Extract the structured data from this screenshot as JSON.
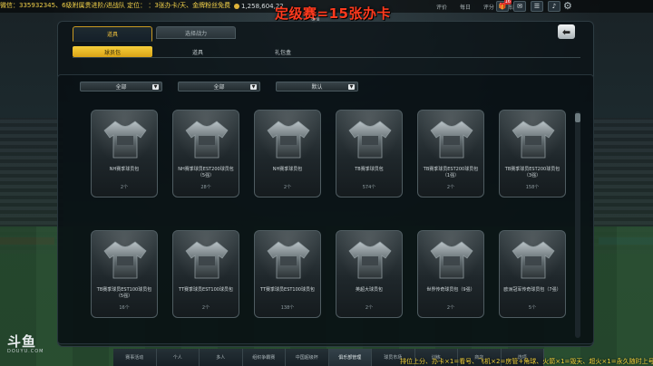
{
  "topbar": {
    "marquee": "微信：335932345、6级附属贵进阶/进战队   定位：    ：3张办卡/天、金牌粉丝免费",
    "stats": "1,258,604,22",
    "links": [
      "评价",
      "每日",
      "评分",
      "每周"
    ],
    "mail_badge": "16",
    "icons": [
      "gift-icon",
      "mail-icon",
      "message-icon",
      "bell-icon",
      "gear-icon"
    ]
  },
  "overlay": {
    "title": "定级赛=15张办卡",
    "subtitle": "道具"
  },
  "tabs_primary": [
    "道具",
    "选择战力"
  ],
  "tabs_secondary": [
    "球员包",
    "道具",
    "礼包盒"
  ],
  "filters": [
    "全部",
    "全部",
    "默认"
  ],
  "cards": [
    {
      "name": "NH赛季球员包",
      "count": "2个"
    },
    {
      "name": "NH赛季球员EST200球员包（5强）",
      "count": "28个"
    },
    {
      "name": "NH赛季球员包",
      "count": "2个"
    },
    {
      "name": "TB赛季球员包",
      "count": "574个"
    },
    {
      "name": "TB赛季球员EST200球员包（1强）",
      "count": "2个"
    },
    {
      "name": "TB赛季球员EST200球员包（3强）",
      "count": "158个"
    },
    {
      "name": "TB赛季球员EST100球员包（5强）",
      "count": "16个"
    },
    {
      "name": "TT赛季球员EST100球员包",
      "count": "2个"
    },
    {
      "name": "TT赛季球员EST100球员包",
      "count": "138个"
    },
    {
      "name": "英超大球员包",
      "count": "2个"
    },
    {
      "name": "世界传奇球员包（9强）",
      "count": "2个"
    },
    {
      "name": "欧洲冠军传奇球员包（7强）",
      "count": "5个"
    }
  ],
  "watermark": {
    "big": "斗鱼",
    "small": "DOUYU.COM"
  },
  "bottom_nav": [
    "赛事活动",
    "个人",
    "多人",
    "组织争霸赛",
    "中国超级杯",
    "俱乐部管理",
    "球员市场",
    "训练",
    "商店",
    "选项"
  ],
  "bottom_info": "排位上分、办卡×1=看号、飞机×2=房管+角球、火箭×1=毁天、超火×1=永久随时上号",
  "colors": {
    "accent": "#f1c23c",
    "overlay": "#ff3a1e"
  }
}
